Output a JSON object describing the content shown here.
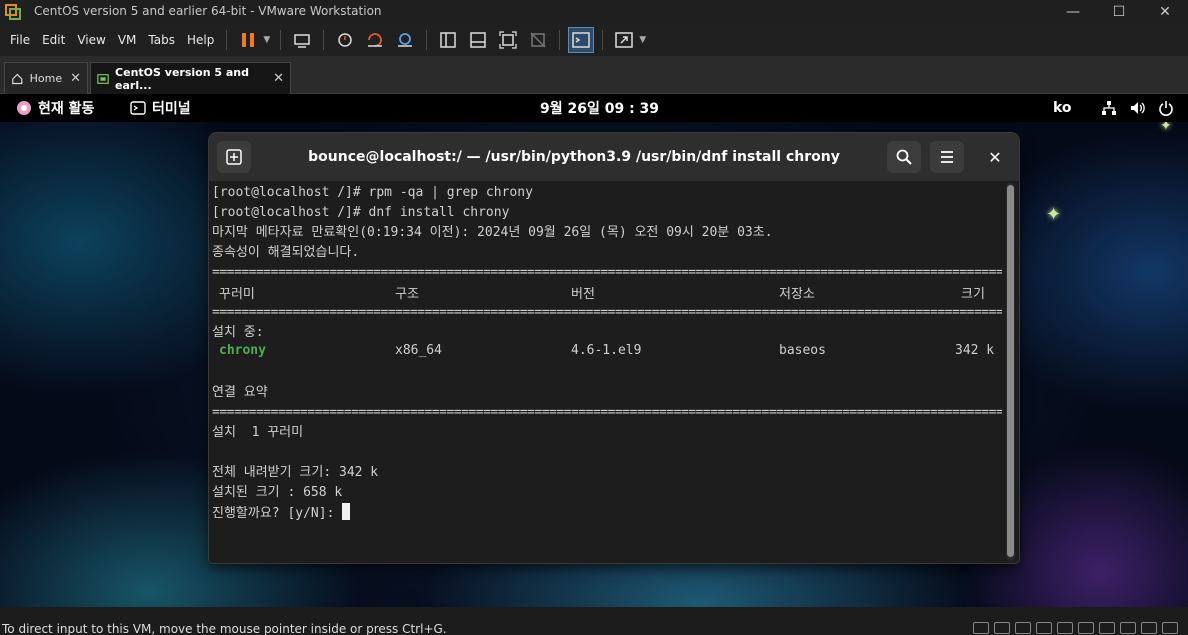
{
  "window": {
    "title": "CentOS version 5 and earlier 64-bit - VMware Workstation",
    "minimize": "—",
    "maximize": "☐",
    "close": "✕"
  },
  "menu": [
    "File",
    "Edit",
    "View",
    "VM",
    "Tabs",
    "Help"
  ],
  "tabs": [
    {
      "label": "Home",
      "close": "✕"
    },
    {
      "label": "CentOS version 5 and earl...",
      "close": "✕"
    }
  ],
  "gnome": {
    "activities": "현재 활동",
    "app": "터미널",
    "clock": "9월 26일  09 : 39",
    "lang": "ko"
  },
  "terminal": {
    "title": "bounce@localhost:/ — /usr/bin/python3.9 /usr/bin/dnf install chrony",
    "close": "✕",
    "lines": {
      "l1": "[root@localhost /]# rpm -qa | grep chrony",
      "l2": "[root@localhost /]# dnf install chrony",
      "l3": "마지막 메타자료 만료확인(0:19:34 이전): 2024년 09월 26일 (목) 오전 09시 20분 03초.",
      "l4": "종속성이 해결되었습니다.",
      "installing": "설치 중:",
      "summary": "연결 요약",
      "install_count": "설치  1 꾸러미",
      "total_download": "전체 내려받기 크기: 342 k",
      "installed_size": "설치된 크기 : 658 k",
      "prompt": "진행할까요? [y/N]: "
    },
    "separator": "==================================================================================================================================================",
    "table": {
      "headers": {
        "package": "꾸러미",
        "arch": "구조",
        "version": "버전",
        "repo": "저장소",
        "size": "크기"
      },
      "row": {
        "package": "chrony",
        "arch": "x86_64",
        "version": "4.6-1.el9",
        "repo": "baseos",
        "size": "342 k"
      }
    }
  },
  "statusbar": {
    "message": "To direct input to this VM, move the mouse pointer inside or press Ctrl+G."
  }
}
